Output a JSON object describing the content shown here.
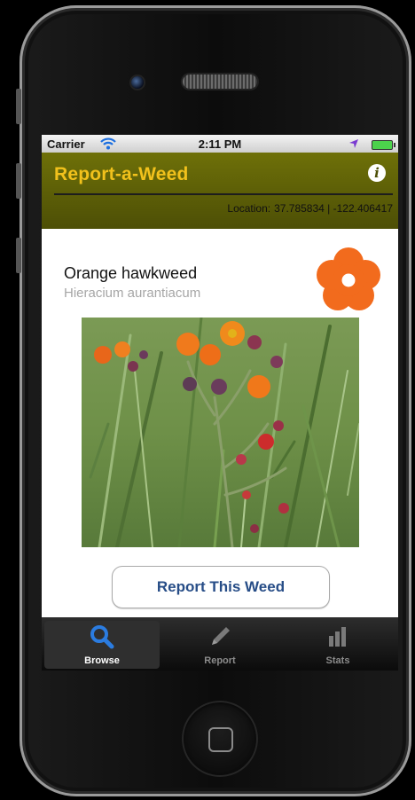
{
  "status_bar": {
    "carrier": "Carrier",
    "time": "2:11 PM"
  },
  "navbar": {
    "title": "Report-a-Weed",
    "location_label": "Location:",
    "location_value": "37.785834 | -122.406417"
  },
  "weed": {
    "common_name": "Orange hawkweed",
    "scientific_name": "Hieracium aurantiacum",
    "icon": "flower-icon",
    "icon_color": "#f26b1d"
  },
  "report_button": {
    "label": "Report This Weed"
  },
  "tab_bar": {
    "selected": "Browse",
    "tabs": [
      {
        "label": "Browse",
        "icon": "magnifier-icon"
      },
      {
        "label": "Report",
        "icon": "pencil-icon"
      },
      {
        "label": "Stats",
        "icon": "bar-chart-icon"
      }
    ]
  },
  "colors": {
    "navbar": "#5c5e07",
    "title": "#f1c11c",
    "button_text": "#274d87",
    "tab_selected_icon": "#2b7ce0"
  }
}
